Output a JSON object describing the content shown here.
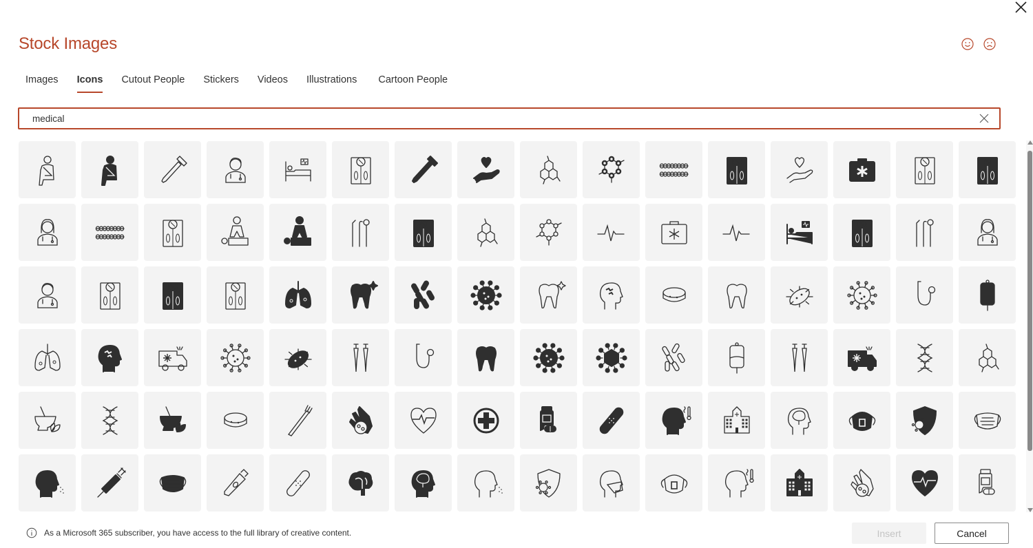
{
  "dialog": {
    "title": "Stock Images",
    "close_icon": "close-icon",
    "feedback": [
      {
        "name": "smile-feedback",
        "icon": "smiley-icon"
      },
      {
        "name": "frown-feedback",
        "icon": "frown-icon"
      }
    ],
    "accent_color": "#b7472a"
  },
  "tabs": [
    {
      "label": "Images",
      "active": false
    },
    {
      "label": "Icons",
      "active": true
    },
    {
      "label": "Cutout People",
      "active": false
    },
    {
      "label": "Stickers",
      "active": false
    },
    {
      "label": "Videos",
      "active": false
    },
    {
      "label": "Illustrations",
      "active": false
    },
    {
      "label": "Cartoon People",
      "active": false
    }
  ],
  "search": {
    "value": "medical",
    "clear_icon": "clear-search-icon"
  },
  "icons": [
    [
      "arm-sling-outline",
      "arm-sling-filled",
      "dropper-outline",
      "doctor-male-outline",
      "hospital-bed-outline",
      "scale-outline",
      "dropper-filled",
      "heart-hand-filled",
      "molecule-hex-outline",
      "molecule-ring-filled",
      "braces-filled",
      "scale-filled",
      "heart-hand-outline",
      "first-aid-kit-filled",
      "scale-outline",
      "scale-filled"
    ],
    [
      "doctor-female-outline",
      "braces-outline",
      "scale-outline",
      "cpr-outline",
      "cpr-filled",
      "dental-tools-filled",
      "scale-filled",
      "molecule-hex-filled",
      "molecule-ring-outline",
      "heartbeat-outline",
      "first-aid-kit-outline",
      "heartbeat-filled",
      "hospital-bed-filled",
      "scale-filled",
      "dental-tools-outline",
      "doctor-female-outline"
    ],
    [
      "doctor-male-outline",
      "scale-outline",
      "scale-filled",
      "scale-outline",
      "lungs-filled",
      "tooth-sparkle-filled",
      "bacteria-filled",
      "virus-filled",
      "tooth-sparkle-outline",
      "head-puzzle-outline",
      "petri-dish-filled",
      "tooth-outline",
      "bacterium-outline",
      "virus-outline",
      "stethoscope-outline",
      "iv-bag-filled"
    ],
    [
      "lungs-outline",
      "head-puzzle-filled",
      "ambulance-outline",
      "virus-outline",
      "bacterium-filled",
      "crutches-filled",
      "stethoscope-filled",
      "tooth-filled",
      "virus-filled",
      "virus-hex-filled",
      "bacteria-outline",
      "iv-bag-outline",
      "crutches-outline",
      "ambulance-filled",
      "dna-filled",
      "molecule-hex-outline"
    ],
    [
      "mortar-herb-outline",
      "dna-outline",
      "mortar-herb-filled",
      "petri-dish-outline",
      "toothbrush-outline",
      "hand-germs-filled",
      "heart-pulse-outline",
      "medical-cross-filled",
      "pill-bottle-filled",
      "bandage-filled",
      "head-fever-filled",
      "hospital-outline",
      "head-brain-outline",
      "respirator-filled",
      "shield-virus-filled",
      "face-mask-outline"
    ],
    [
      "head-sneeze-filled",
      "syringe-filled",
      "face-mask-filled",
      "ointment-tube-outline",
      "bandage-outline",
      "brain-filled",
      "head-brain-filled",
      "head-sneeze-outline",
      "shield-virus-outline",
      "head-mask-outline",
      "respirator-outline",
      "head-fever-outline",
      "hospital-filled",
      "hand-germs-outline",
      "heart-pulse-filled",
      "pill-bottle-outline"
    ]
  ],
  "footer": {
    "info_text": "As a Microsoft 365 subscriber, you have access to the full library of creative content.",
    "insert_label": "Insert",
    "insert_enabled": false,
    "cancel_label": "Cancel"
  },
  "scroll": {
    "position_fraction": 0.0,
    "visible_fraction": 0.81
  }
}
